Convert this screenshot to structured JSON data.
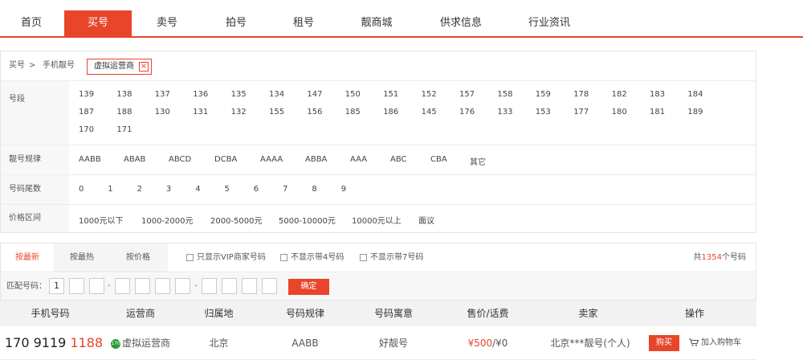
{
  "nav": {
    "items": [
      {
        "label": "首页",
        "active": false
      },
      {
        "label": "买号",
        "active": true
      },
      {
        "label": "卖号",
        "active": false
      },
      {
        "label": "拍号",
        "active": false
      },
      {
        "label": "租号",
        "active": false
      },
      {
        "label": "靓商城",
        "active": false
      },
      {
        "label": "供求信息",
        "active": false
      },
      {
        "label": "行业资讯",
        "active": false
      }
    ]
  },
  "breadcrumb": {
    "root": "买号",
    "separator": ">",
    "current": "手机靓号",
    "tag": "虚拟运营商",
    "tag_close": "×"
  },
  "filters": {
    "segment": {
      "label": "号段",
      "options": [
        "139",
        "138",
        "137",
        "136",
        "135",
        "134",
        "147",
        "150",
        "151",
        "152",
        "157",
        "158",
        "159",
        "178",
        "182",
        "183",
        "184",
        "187",
        "188",
        "130",
        "131",
        "132",
        "155",
        "156",
        "185",
        "186",
        "145",
        "176",
        "133",
        "153",
        "177",
        "180",
        "181",
        "189",
        "170",
        "171"
      ]
    },
    "pattern": {
      "label": "靓号规律",
      "options": [
        "AABB",
        "ABAB",
        "ABCD",
        "DCBA",
        "AAAA",
        "ABBA",
        "AAA",
        "ABC",
        "CBA",
        "其它"
      ]
    },
    "tail": {
      "label": "号码尾数",
      "options": [
        "0",
        "1",
        "2",
        "3",
        "4",
        "5",
        "6",
        "7",
        "8",
        "9"
      ]
    },
    "price": {
      "label": "价格区间",
      "options": [
        "1000元以下",
        "1000-2000元",
        "2000-5000元",
        "5000-10000元",
        "10000元以上",
        "面议"
      ]
    }
  },
  "sortbar": {
    "tabs": [
      {
        "label": "按最新",
        "active": true
      },
      {
        "label": "按最热",
        "active": false
      },
      {
        "label": "按价格",
        "active": false
      }
    ],
    "checkboxes": [
      {
        "label": "只显示VIP商家号码",
        "checked": false
      },
      {
        "label": "不显示带4号码",
        "checked": false
      },
      {
        "label": "不显示带7号码",
        "checked": false
      }
    ],
    "total_prefix": "共",
    "total_count": "1354",
    "total_suffix": "个号码"
  },
  "match": {
    "label": "匹配号码：",
    "digits": [
      "1",
      "",
      "",
      "",
      "",
      "",
      "",
      "",
      "",
      "",
      "",
      ""
    ],
    "dash": "-",
    "confirm": "确定"
  },
  "table": {
    "headers": [
      "手机号码",
      "运营商",
      "归属地",
      "号码规律",
      "号码寓意",
      "售价/话费",
      "卖家",
      "操作"
    ],
    "rows": [
      {
        "phone_head": "170 9119",
        "phone_tail": "1188",
        "operator_logo": "170",
        "operator": "虚拟运营商",
        "location": "北京",
        "pattern": "AABB",
        "meaning": "好靓号",
        "price": "¥500",
        "fee": "/¥0",
        "seller": "北京***靓号(个人)",
        "buy": "购买",
        "cart": "加入购物车"
      }
    ]
  },
  "colors": {
    "accent": "#e8452b",
    "operator_green": "#2a9b3c"
  }
}
